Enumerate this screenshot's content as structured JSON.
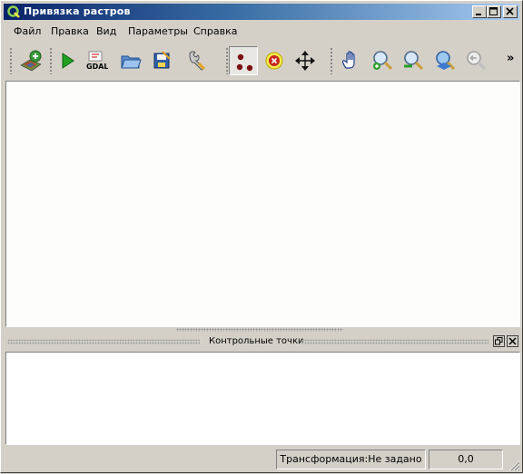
{
  "window": {
    "title": "Привязка растров"
  },
  "menu": {
    "items": [
      {
        "label": "Файл"
      },
      {
        "label": "Правка"
      },
      {
        "label": "Вид"
      },
      {
        "label": "Параметры"
      },
      {
        "label": "Справка"
      }
    ]
  },
  "toolbar": {
    "gdal_script_label": "GDAL",
    "overflow_label": "»"
  },
  "dock": {
    "title": "Контрольные точки"
  },
  "status": {
    "transform": "Трансформация:Не задано",
    "coordinates": "0,0"
  }
}
